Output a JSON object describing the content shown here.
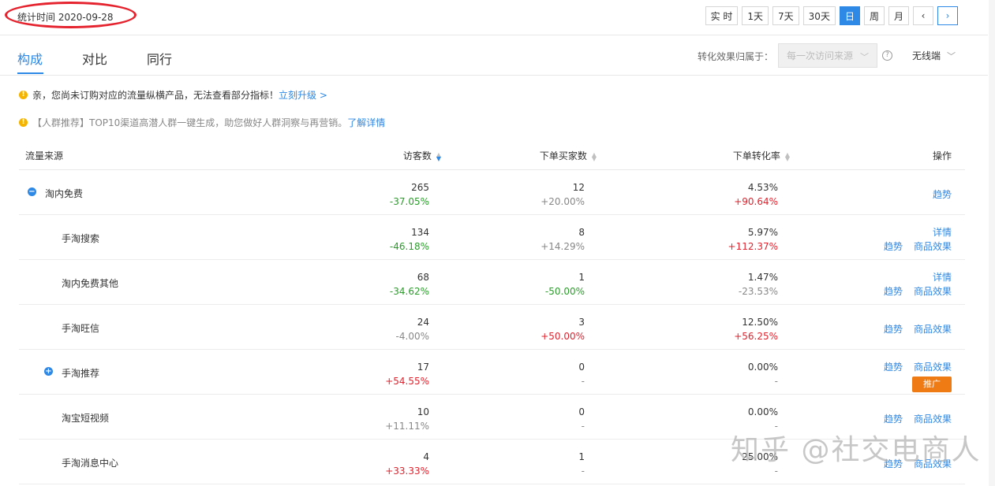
{
  "header": {
    "stat_time": "统计时间 2020-09-28",
    "ranges": [
      "实 时",
      "1天",
      "7天",
      "30天",
      "日",
      "周",
      "月"
    ],
    "active_range": "日",
    "prev": "‹",
    "next": "›"
  },
  "tabs": {
    "items": [
      "构成",
      "对比",
      "同行"
    ],
    "attr_label": "转化效果归属于：",
    "attr_value": "每一次访问来源",
    "device": "无线端"
  },
  "notices": {
    "n1_text": "亲，您尚未订购对应的流量纵横产品，无法查看部分指标！",
    "n1_link": "立刻升级 >",
    "n2_text": "【人群推荐】TOP10渠道高潜人群一键生成，助您做好人群洞察与再营销。",
    "n2_link": "了解详情"
  },
  "table": {
    "headers": {
      "source": "流量来源",
      "visitors": "访客数",
      "buyers": "下单买家数",
      "rate": "下单转化率",
      "ops": "操作"
    },
    "rows": [
      {
        "name": "淘内免费",
        "toggle": "−",
        "v": "265",
        "vc": "-37.05%",
        "vcc": "green",
        "b": "12",
        "bc": "+20.00%",
        "bcc": "gray",
        "r": "4.53%",
        "rc": "+90.64%",
        "rcc": "red",
        "ops1": "趋势"
      },
      {
        "name": "手淘搜索",
        "v": "134",
        "vc": "-46.18%",
        "vcc": "green",
        "b": "8",
        "bc": "+14.29%",
        "bcc": "gray",
        "r": "5.97%",
        "rc": "+112.37%",
        "rcc": "red",
        "ops_top": "详情",
        "ops1": "趋势",
        "ops2": "商品效果"
      },
      {
        "name": "淘内免费其他",
        "v": "68",
        "vc": "-34.62%",
        "vcc": "green",
        "b": "1",
        "bc": "-50.00%",
        "bcc": "green",
        "r": "1.47%",
        "rc": "-23.53%",
        "rcc": "gray",
        "ops_top": "详情",
        "ops1": "趋势",
        "ops2": "商品效果"
      },
      {
        "name": "手淘旺信",
        "v": "24",
        "vc": "-4.00%",
        "vcc": "gray",
        "b": "3",
        "bc": "+50.00%",
        "bcc": "red",
        "r": "12.50%",
        "rc": "+56.25%",
        "rcc": "red",
        "ops1": "趋势",
        "ops2": "商品效果"
      },
      {
        "name": "手淘推荐",
        "toggle": "+",
        "v": "17",
        "vc": "+54.55%",
        "vcc": "red",
        "b": "0",
        "bc": "-",
        "bcc": "gray",
        "r": "0.00%",
        "rc": "-",
        "rcc": "gray",
        "ops1": "趋势",
        "ops2": "商品效果",
        "promo": "推广"
      },
      {
        "name": "淘宝短视频",
        "v": "10",
        "vc": "+11.11%",
        "vcc": "gray",
        "b": "0",
        "bc": "-",
        "bcc": "gray",
        "r": "0.00%",
        "rc": "-",
        "rcc": "gray",
        "ops1": "趋势",
        "ops2": "商品效果"
      },
      {
        "name": "手淘消息中心",
        "v": "4",
        "vc": "+33.33%",
        "vcc": "red",
        "b": "1",
        "bc": "-",
        "bcc": "gray",
        "r": "25.00%",
        "rc": "-",
        "rcc": "gray",
        "ops1": "趋势",
        "ops2": "商品效果"
      }
    ]
  },
  "watermark": "知乎 @社交电商人",
  "colors": {
    "accent": "#2e88e5",
    "up": "#e0232e",
    "down": "#2a9d2a",
    "promo": "#ef7b14",
    "highlight": "#e5232e"
  }
}
